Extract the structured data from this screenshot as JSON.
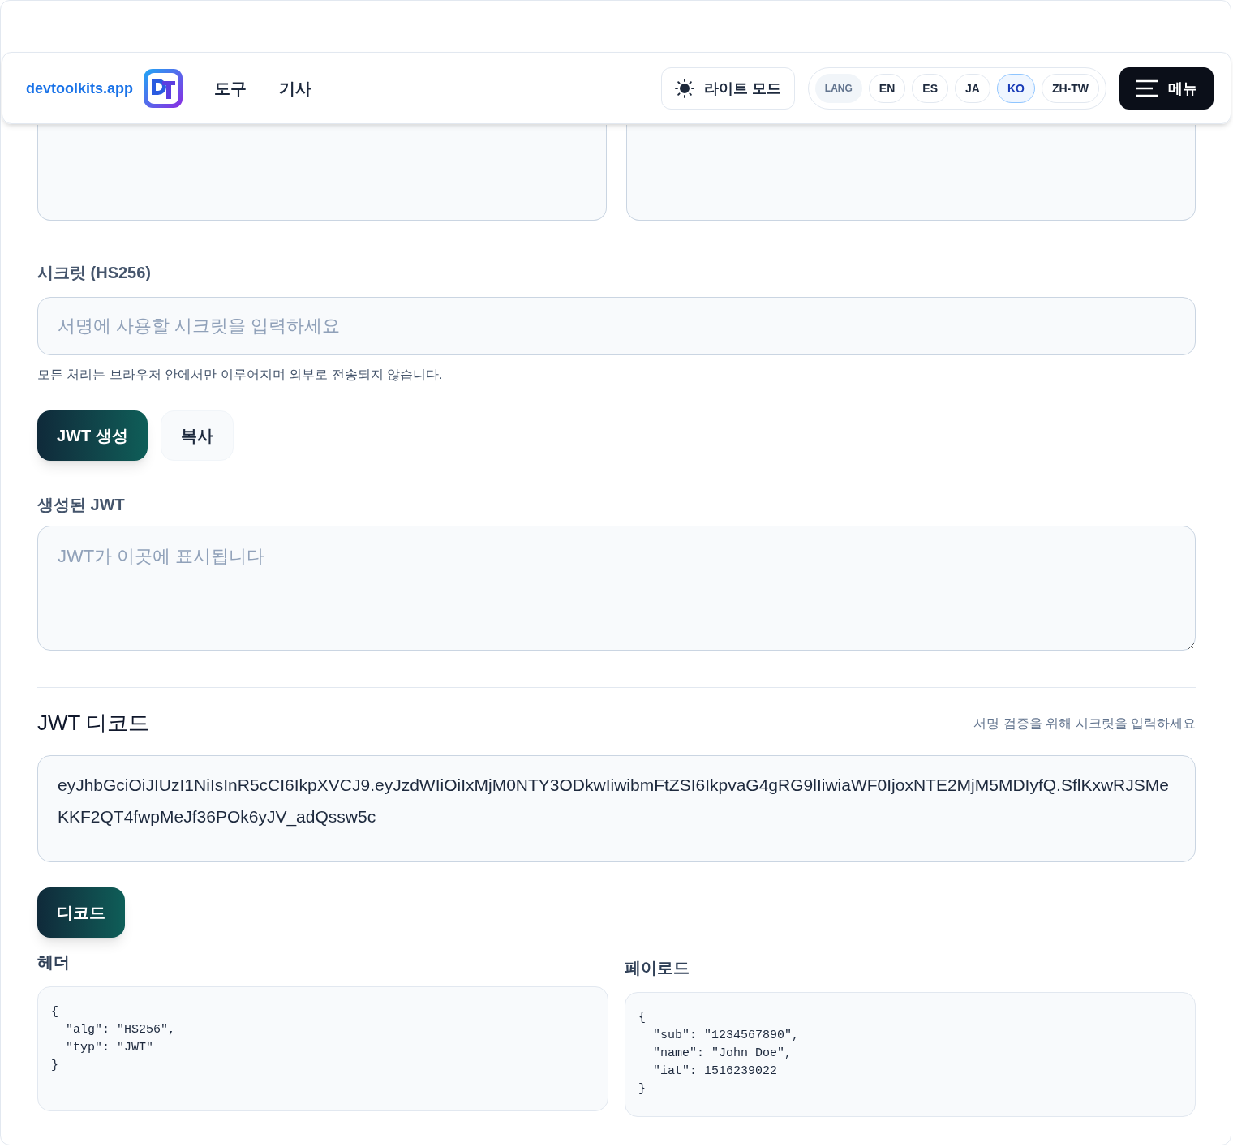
{
  "header": {
    "brand": "devtoolkits.app",
    "nav": [
      {
        "label": "도구"
      },
      {
        "label": "기사"
      }
    ],
    "theme_button": "라이트 모드",
    "lang_label": "LANG",
    "languages": [
      {
        "label": "EN",
        "selected": false
      },
      {
        "label": "ES",
        "selected": false
      },
      {
        "label": "JA",
        "selected": false
      },
      {
        "label": "KO",
        "selected": true
      },
      {
        "label": "ZH-TW",
        "selected": false
      }
    ],
    "menu_button": "메뉴"
  },
  "encoder": {
    "secret_label": "시크릿 (HS256)",
    "secret_placeholder": "서명에 사용할 시크릿을 입력하세요",
    "note": "모든 처리는 브라우저 안에서만 이루어지며 외부로 전송되지 않습니다.",
    "buttons": [
      {
        "label": "JWT 생성",
        "kind": "primary"
      },
      {
        "label": "복사",
        "kind": "secondary"
      }
    ],
    "output_label": "생성된 JWT",
    "output_placeholder": "JWT가 이곳에 표시됩니다"
  },
  "decoder": {
    "title": "JWT 디코드",
    "hint": "서명 검증을 위해 시크릿을 입력하세요",
    "token": "eyJhbGciOiJIUzI1NiIsInR5cCI6IkpXVCJ9.eyJzdWIiOiIxMjM0NTY3ODkwIiwibmFtZSI6IkpvaG4gRG9lIiwiaWF0IjoxNTE2MjM5MDIyfQ.SflKxwRJSMeKKF2QT4fwpMeJf36POk6yJV_adQssw5c",
    "button": "디코드",
    "header_label": "헤더",
    "header_json": "{\n  \"alg\": \"HS256\",\n  \"typ\": \"JWT\"\n}",
    "payload_label": "페이로드",
    "payload_json": "{\n  \"sub\": \"1234567890\",\n  \"name\": \"John Doe\",\n  \"iat\": 1516239022\n}"
  }
}
